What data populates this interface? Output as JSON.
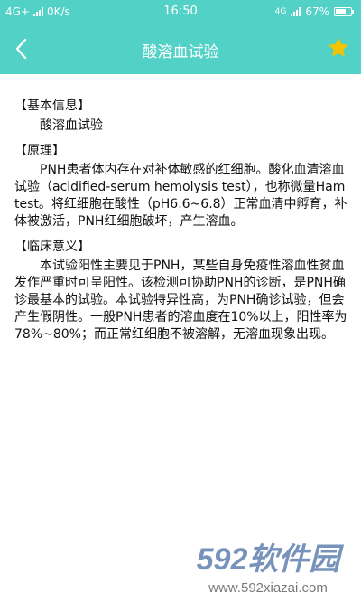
{
  "status_bar": {
    "network": "4G+",
    "speed": "0K/s",
    "time": "16:50",
    "network_right": "4G",
    "battery": "67%",
    "battery_level": 0.67
  },
  "header": {
    "title": "酸溶血试验",
    "back_icon": "chevron-left-icon",
    "favorite_icon": "star-icon",
    "favorite_color": "#f5c400"
  },
  "colors": {
    "accent": "#52d1c6"
  },
  "sections": [
    {
      "title": "【基本信息】",
      "body": "酸溶血试验"
    },
    {
      "title": "【原理】",
      "body": "PNH患者体内存在对补体敏感的红细胞。酸化血清溶血试验（acidified-serum hemolysis test），也称微量Ham test。将红细胞在酸性（pH6.6~6.8）正常血清中孵育，补体被激活，PNH红细胞破坏，产生溶血。"
    },
    {
      "title": "【临床意义】",
      "body": "本试验阳性主要见于PNH，某些自身免疫性溶血性贫血发作严重时可呈阳性。该检测可协助PNH的诊断，是PNH确诊最基本的试验。本试验特异性高，为PNH确诊试验，但会产生假阴性。一般PNH患者的溶血度在10%以上，阳性率为78%~80%；而正常红细胞不被溶解，无溶血现象出现。"
    }
  ],
  "watermark": {
    "brand": "592软件园",
    "url": "www.592xiazai.com"
  }
}
